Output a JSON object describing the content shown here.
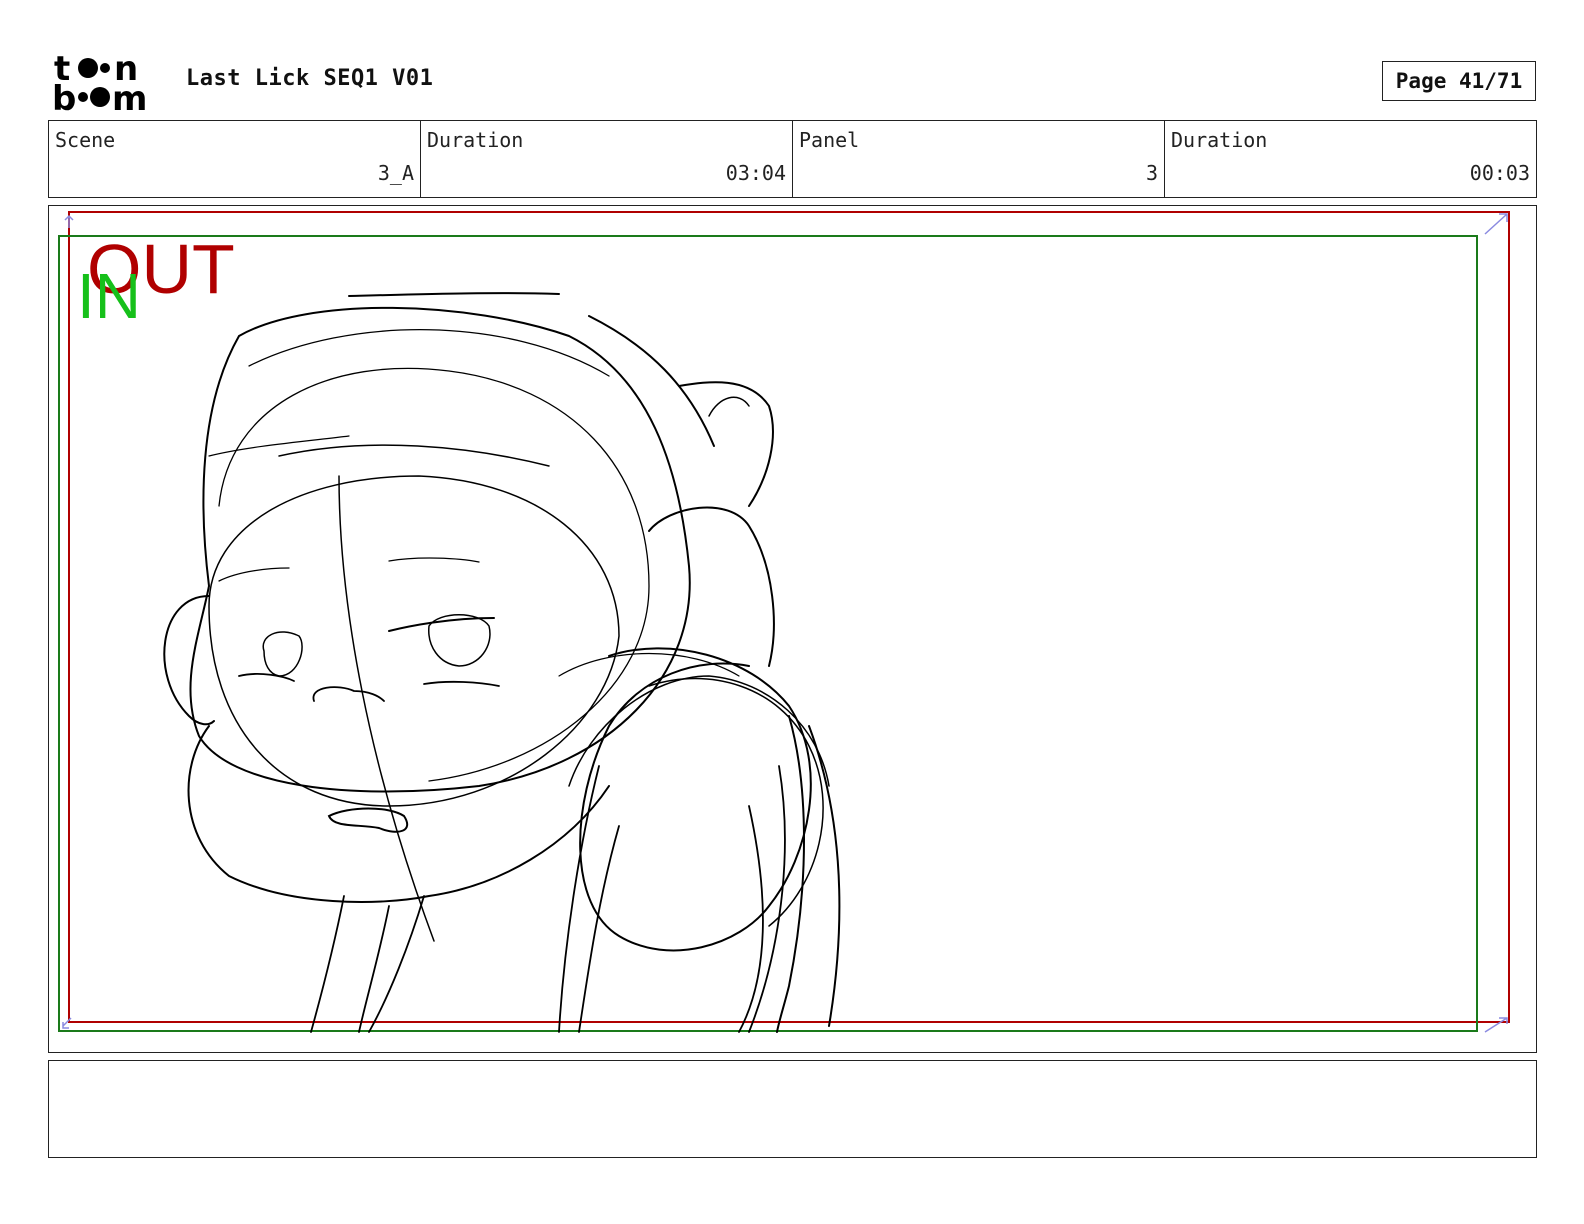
{
  "header": {
    "logo_text": "toon boom",
    "title": "Last Lick SEQ1 V01",
    "page": "Page 41/71"
  },
  "info": {
    "scene_label": "Scene",
    "scene_value": "3_A",
    "scene_duration_label": "Duration",
    "scene_duration_value": "03:04",
    "panel_label": "Panel",
    "panel_value": "3",
    "panel_duration_label": "Duration",
    "panel_duration_value": "00:03"
  },
  "panel": {
    "out_label": "OUT",
    "in_label": "IN",
    "out_frame_color": "#b00000",
    "in_frame_color": "#1a7a1a"
  },
  "notes": {
    "text": ""
  }
}
